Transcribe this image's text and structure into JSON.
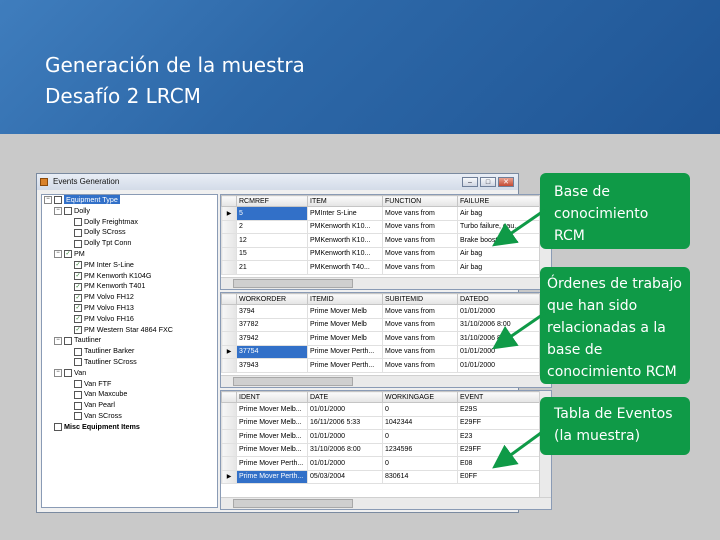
{
  "slide": {
    "title_lines": [
      "Generación de la muestra",
      "Desafío 2 LRCM"
    ],
    "colors": {
      "header": "#2d68a8",
      "callout": "#0f9a47",
      "selection": "#3270c8"
    }
  },
  "window": {
    "title": "Events Generation",
    "buttons": {
      "minimize": "–",
      "maximize": "□",
      "close": "✕"
    },
    "icons": {
      "app": "app-icon"
    }
  },
  "tree": {
    "items": [
      {
        "label": "Equipment Type",
        "exp": "−"
      },
      {
        "label": "Dolly",
        "exp": "−"
      },
      {
        "label": "Dolly Freightmax"
      },
      {
        "label": "Dolly SCross"
      },
      {
        "label": "Dolly Tpt Conn"
      },
      {
        "label": "PM",
        "exp": "−"
      },
      {
        "label": "PM Inter S-Line"
      },
      {
        "label": "PM Kenworth K104G"
      },
      {
        "label": "PM Kenworth T401"
      },
      {
        "label": "PM Volvo FH12"
      },
      {
        "label": "PM Volvo FH13"
      },
      {
        "label": "PM Volvo FH16"
      },
      {
        "label": "PM Western Star 4864 FXC"
      },
      {
        "label": "Tautliner",
        "exp": "−"
      },
      {
        "label": "Tautliner Barker"
      },
      {
        "label": "Tautliner SCross"
      },
      {
        "label": "Van",
        "exp": "−"
      },
      {
        "label": "Van FTF"
      },
      {
        "label": "Van Maxcube"
      },
      {
        "label": "Van Pearl"
      },
      {
        "label": "Van SCross"
      },
      {
        "label": "Misc Equipment Items"
      }
    ]
  },
  "grid1": {
    "headers": [
      "",
      "RCMREF",
      "ITEM",
      "FUNCTION",
      "FAILURE"
    ],
    "rows": [
      {
        "marker": "▶",
        "cells": [
          "5",
          "PMInter S-Line",
          "Move vans from",
          "Air bag"
        ]
      },
      {
        "marker": "",
        "cells": [
          "2",
          "PMKenworth K10...",
          "Move vans from",
          "Turbo failure, cau..."
        ]
      },
      {
        "marker": "",
        "cells": [
          "12",
          "PMKenworth K10...",
          "Move vans from",
          "Brake booster fai..."
        ]
      },
      {
        "marker": "",
        "cells": [
          "15",
          "PMKenworth K10...",
          "Move vans from",
          "Air bag"
        ]
      },
      {
        "marker": "",
        "cells": [
          "21",
          "PMKenworth T40...",
          "Move vans from",
          "Air bag"
        ]
      }
    ]
  },
  "grid2": {
    "headers": [
      "",
      "WORKORDER",
      "ITEMID",
      "SUBITEMID",
      "DATEDO"
    ],
    "rows": [
      {
        "marker": "",
        "cells": [
          "3794",
          "Prime Mover Melb",
          "Move vans from",
          "01/01/2000"
        ]
      },
      {
        "marker": "",
        "cells": [
          "37782",
          "Prime Mover Melb",
          "Move vans from",
          "31/10/2006 8:00"
        ]
      },
      {
        "marker": "",
        "cells": [
          "37942",
          "Prime Mover Melb",
          "Move vans from",
          "31/10/2006 8:00"
        ]
      },
      {
        "marker": "▶",
        "cells": [
          "37754",
          "Prime Mover Perth...",
          "Move vans from",
          "01/01/2000"
        ]
      },
      {
        "marker": "",
        "cells": [
          "37943",
          "Prime Mover Perth...",
          "Move vans from",
          "01/01/2000"
        ]
      }
    ]
  },
  "grid3": {
    "headers": [
      "",
      "IDENT",
      "DATE",
      "WORKINGAGE",
      "EVENT"
    ],
    "rows": [
      {
        "marker": "",
        "cells": [
          "Prime Mover Melb...",
          "01/01/2000",
          "0",
          "E29S"
        ]
      },
      {
        "marker": "",
        "cells": [
          "Prime Mover Melb...",
          "16/11/2006 5:33",
          "1042344",
          "E29FF"
        ]
      },
      {
        "marker": "",
        "cells": [
          "Prime Mover Melb...",
          "01/01/2000",
          "0",
          "E23"
        ]
      },
      {
        "marker": "",
        "cells": [
          "Prime Mover Melb...",
          "31/10/2006 8:00",
          "1234596",
          "E29FF"
        ]
      },
      {
        "marker": "",
        "cells": [
          "Prime Mover Perth...",
          "01/01/2000",
          "0",
          "E08"
        ]
      },
      {
        "marker": "▶",
        "cells": [
          "Prime Mover Perth...",
          "05/03/2004",
          "830614",
          "E0FF"
        ]
      }
    ]
  },
  "callouts": [
    {
      "lines": [
        "Base de",
        "conocimiento",
        "RCM"
      ]
    },
    {
      "lines": [
        "Órdenes de trabajo",
        "que han sido",
        "relacionadas a la",
        "base de",
        "conocimiento RCM"
      ]
    },
    {
      "lines": [
        "Tabla de Eventos",
        "(la muestra)"
      ]
    }
  ]
}
